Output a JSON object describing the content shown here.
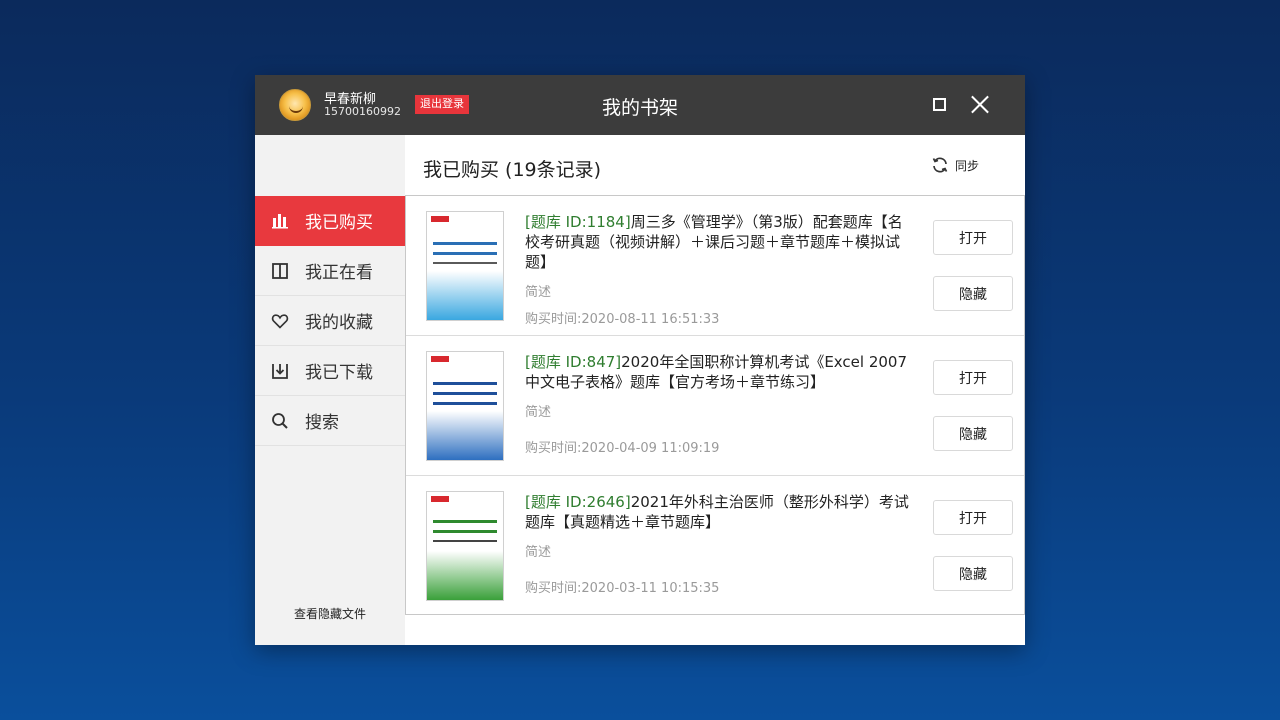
{
  "window": {
    "title": "我的书架",
    "user": {
      "name": "早春新柳",
      "phone": "15700160992"
    },
    "logout_label": "退出登录"
  },
  "sidebar": {
    "items": [
      {
        "label": "我已购买",
        "icon": "bar-chart-icon",
        "active": true
      },
      {
        "label": "我正在看",
        "icon": "book-open-icon",
        "active": false
      },
      {
        "label": "我的收藏",
        "icon": "heart-icon",
        "active": false
      },
      {
        "label": "我已下载",
        "icon": "download-icon",
        "active": false
      },
      {
        "label": "搜索",
        "icon": "search-icon",
        "active": false
      }
    ],
    "hidden_files_label": "查看隐藏文件"
  },
  "main": {
    "title": "我已购买 (19条记录)",
    "sync_label": "同步",
    "books": [
      {
        "tag": "[题库 ID:1184]",
        "title": "周三多《管理学》（第3版）配套题库【名校考研真题（视频讲解）＋课后习题＋章节题库＋模拟试题】",
        "desc": "简述",
        "date": "购买时间:2020-08-11 16:51:33",
        "open_label": "打开",
        "hide_label": "隐藏",
        "cover_color": "#3aa7e0"
      },
      {
        "tag": "[题库 ID:847]",
        "title": "2020年全国职称计算机考试《Excel 2007中文电子表格》题库【官方考场＋章节练习】",
        "desc": "简述",
        "date": "购买时间:2020-04-09 11:09:19",
        "open_label": "打开",
        "hide_label": "隐藏",
        "cover_color": "#2e6fc0"
      },
      {
        "tag": "[题库 ID:2646]",
        "title": "2021年外科主治医师（整形外科学）考试题库【真题精选＋章节题库】",
        "desc": "简述",
        "date": "购买时间:2020-03-11 10:15:35",
        "open_label": "打开",
        "hide_label": "隐藏",
        "cover_color": "#3aa03a"
      }
    ]
  }
}
